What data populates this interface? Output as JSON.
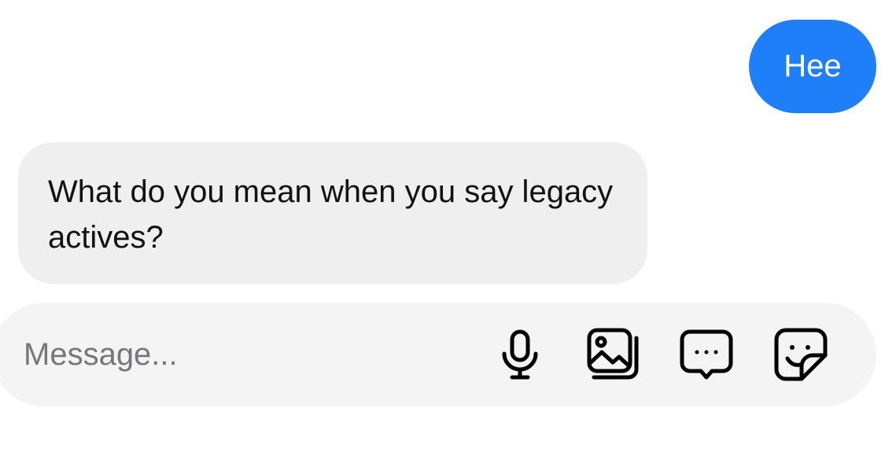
{
  "thread": {
    "messages": [
      {
        "direction": "outgoing",
        "text": "Hee"
      },
      {
        "direction": "incoming",
        "text": "What do you mean when you say legacy actives?"
      }
    ]
  },
  "composer": {
    "placeholder": "Message...",
    "value": "",
    "icons": [
      "microphone-icon",
      "gallery-icon",
      "message-options-icon",
      "sticker-icon"
    ]
  },
  "colors": {
    "outgoing_bubble": "#1f7ff9",
    "incoming_bubble": "#efeff0",
    "composer_background": "#f4f4f5",
    "placeholder_text": "#77777b"
  }
}
